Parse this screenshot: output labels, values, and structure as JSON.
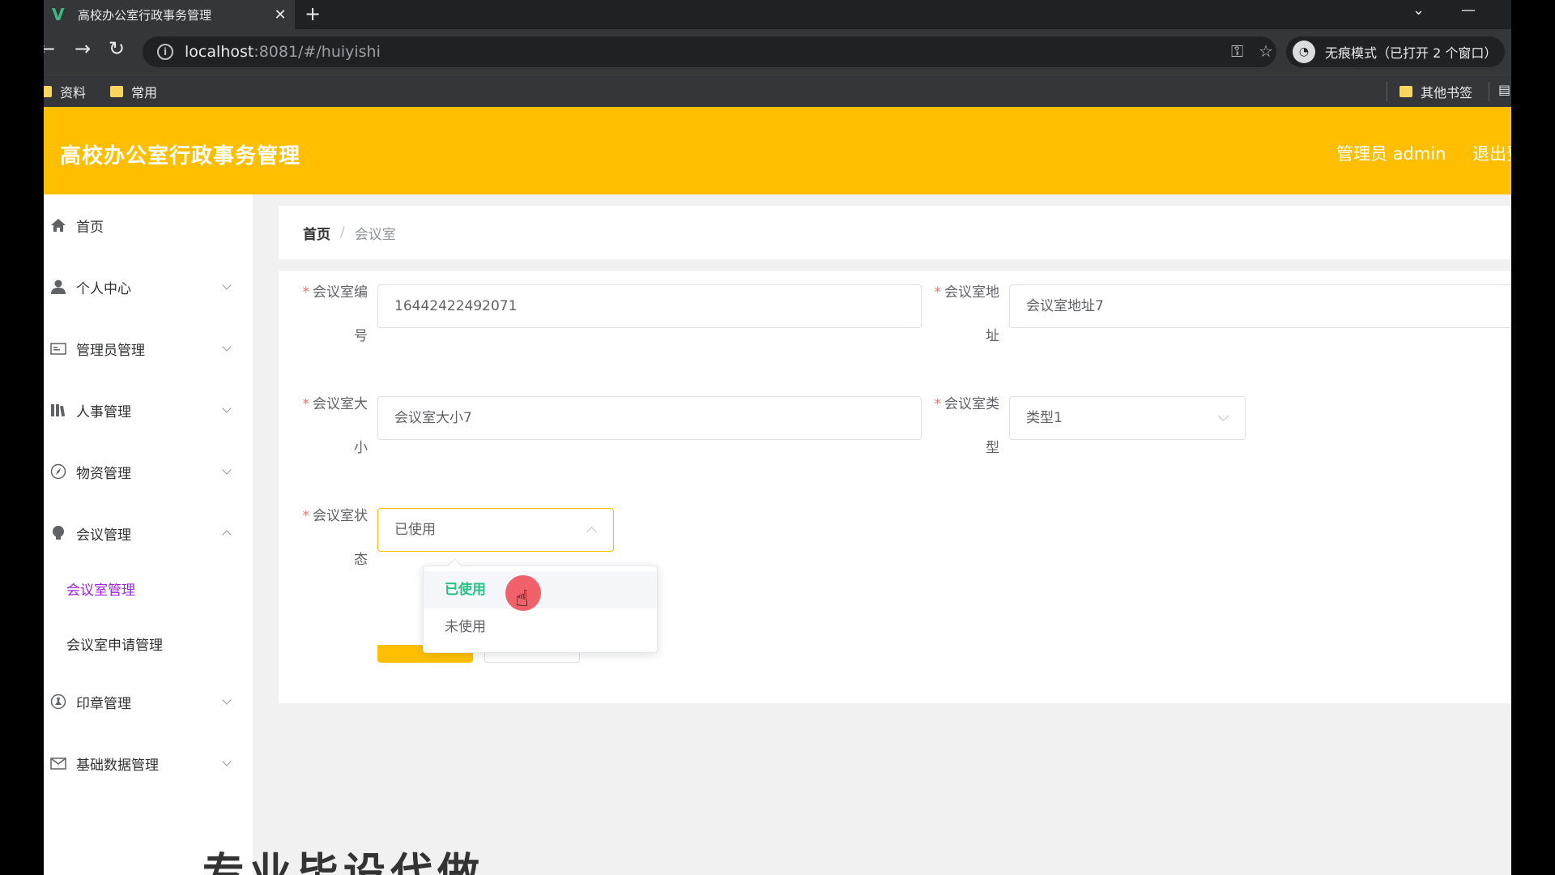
{
  "browser": {
    "tab_title": "高校办公室行政事务管理",
    "tab_logo": "V",
    "new_tab": "+",
    "url_host": "localhost",
    "url_rest": ":8081/#/huiyishi",
    "incognito": "无痕模式（已打开 2 个窗口）",
    "bookmarks": [
      "资料",
      "常用"
    ],
    "other_bookmarks": "其他书签"
  },
  "header": {
    "title": "高校办公室行政事务管理",
    "user": "管理员 admin",
    "logout": "退出登录"
  },
  "sidebar": {
    "items": [
      {
        "label": "首页",
        "icon": "home-icon"
      },
      {
        "label": "个人中心",
        "icon": "user-icon"
      },
      {
        "label": "管理员管理",
        "icon": "id-card-icon"
      },
      {
        "label": "人事管理",
        "icon": "books-icon"
      },
      {
        "label": "物资管理",
        "icon": "compass-icon"
      },
      {
        "label": "会议管理",
        "icon": "bulb-icon"
      },
      {
        "label": "印章管理",
        "icon": "stamp-icon"
      },
      {
        "label": "基础数据管理",
        "icon": "mail-icon"
      }
    ],
    "sub_items": [
      "会议室管理",
      "会议室申请管理"
    ],
    "active_color": "#a020f0"
  },
  "breadcrumb": {
    "home": "首页",
    "separator": "/",
    "current": "会议室"
  },
  "form": {
    "star": "*",
    "room_no_label_1": "会议室编",
    "room_no_label_2": "号",
    "room_no_value": "16442422492071",
    "address_label_1": "会议室地",
    "address_label_2": "址",
    "address_value": "会议室地址7",
    "size_label_1": "会议室大",
    "size_label_2": "小",
    "size_value": "会议室大小7",
    "type_label_1": "会议室类",
    "type_label_2": "型",
    "type_value": "类型1",
    "status_label_1": "会议室状",
    "status_label_2": "态",
    "status_value": "已使用",
    "status_options": [
      "已使用",
      "未使用"
    ]
  },
  "colors": {
    "accent": "#ffbf00",
    "selected_option": "#26c281"
  },
  "watermark": "专业毕设代做"
}
